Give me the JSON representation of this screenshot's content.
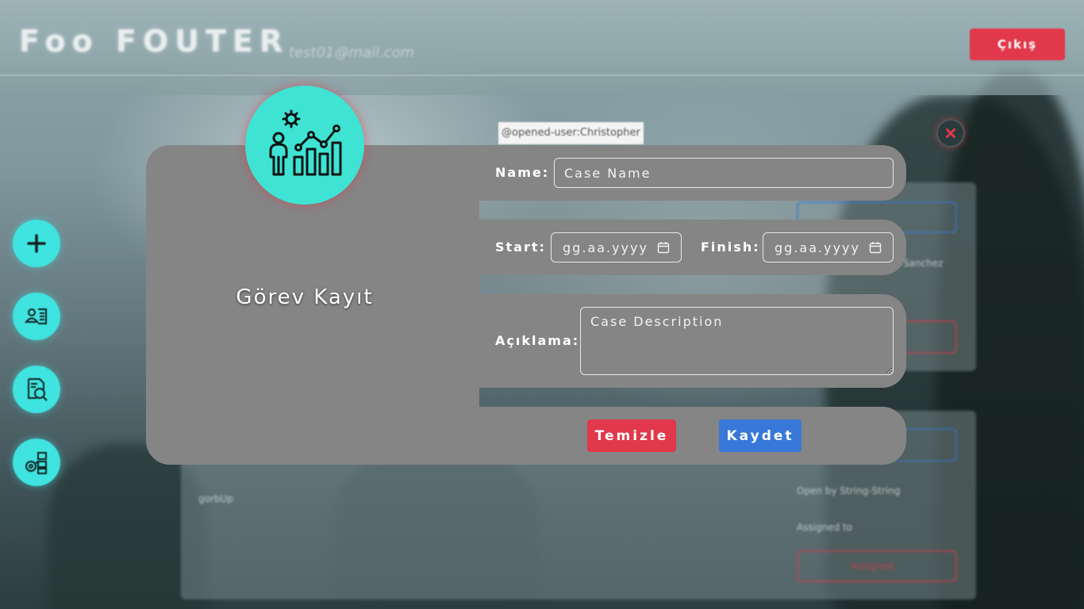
{
  "header": {
    "app_title": "Foo FOUTER",
    "user_email": "test01@mail.com",
    "exit_label": "Çıkış"
  },
  "background": {
    "opened_user": "@opened-user:Christopher",
    "panel_texts": [
      "Sanchez",
      "gorbUp",
      "Open by String-String",
      "Assigned to",
      "Assigned"
    ]
  },
  "sidebar": {
    "items": [
      {
        "icon": "plus-icon"
      },
      {
        "icon": "user-list-icon"
      },
      {
        "icon": "search-document-icon"
      },
      {
        "icon": "workflow-icon"
      }
    ]
  },
  "modal": {
    "title": "Görev Kayıt",
    "logo_icon": "person-analytics-icon",
    "name_label": "Name:",
    "name_placeholder": "Case Name",
    "start_label": "Start:",
    "start_placeholder": "gg.aa.yyyy",
    "finish_label": "Finish:",
    "finish_placeholder": "gg.aa.yyyy",
    "description_label": "Açıklama:",
    "description_placeholder": "Case Description",
    "clear_label": "Temizle",
    "save_label": "Kaydet",
    "close_icon": "close-icon"
  },
  "colors": {
    "accent_cyan": "#3fe3d3",
    "danger": "#e1384b",
    "primary": "#3878d8",
    "modal_gray": "#858585"
  }
}
